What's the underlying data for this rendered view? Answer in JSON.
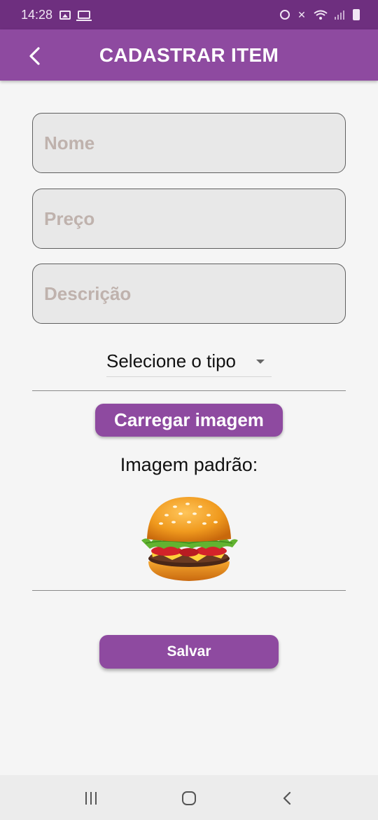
{
  "status_bar": {
    "time": "14:28",
    "icons": [
      "photo-icon",
      "laptop-icon",
      "alarm-icon",
      "mute-icon",
      "wifi-icon",
      "signal-icon",
      "battery-icon"
    ]
  },
  "app_bar": {
    "title": "CADASTRAR ITEM",
    "back_icon": "back-arrow-icon",
    "color": "#8e4aa0"
  },
  "form": {
    "name_placeholder": "Nome",
    "name_value": "",
    "price_placeholder": "Preço",
    "price_value": "",
    "description_placeholder": "Descrição",
    "description_value": "",
    "type_select": {
      "selected": "Selecione o tipo"
    },
    "load_image_button": "Carregar imagem",
    "default_image_label": "Imagem padrão:",
    "default_image": "burger-image",
    "save_button": "Salvar"
  },
  "nav_bar": {
    "recents_icon": "recents-icon",
    "home_icon": "home-icon",
    "back_icon": "back-icon"
  },
  "colors": {
    "status_bar": "#6e2f7f",
    "primary": "#8e4aa0",
    "background": "#f5f5f5",
    "field_background": "#e8e8e8",
    "placeholder": "#bfb2ad"
  }
}
